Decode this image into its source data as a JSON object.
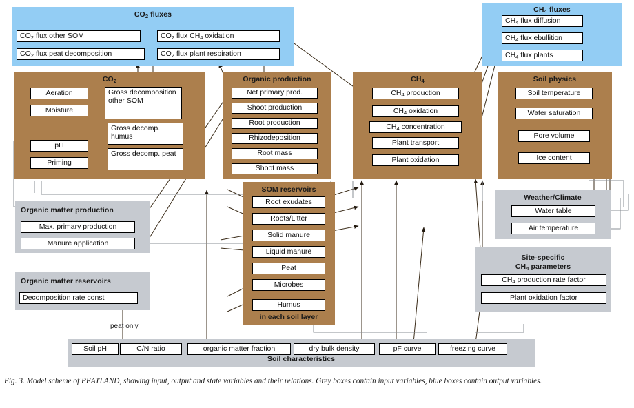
{
  "figure": {
    "caption": "Fig. 3.  Model scheme of PEATLAND, showing input, output and state variables and their relations. Grey boxes contain input variables, blue boxes contain output variables."
  },
  "colors": {
    "output_panel": "#93cdf4",
    "state_panel": "#ac7f4d",
    "input_panel": "#c6cad0",
    "node_fill": "#ffffff",
    "line": "#000000"
  },
  "panels": {
    "co2_fluxes": {
      "title": "CO2 fluxes",
      "kind": "output",
      "nodes": [
        {
          "label": "CO2 flux other SOM"
        },
        {
          "label": "CO2 flux peat decomposition"
        },
        {
          "label": "CO2 flux CH4 oxidation"
        },
        {
          "label": "CO2 flux plant respiration"
        }
      ]
    },
    "ch4_fluxes": {
      "title": "CH4 fluxes",
      "kind": "output",
      "nodes": [
        {
          "label": "CH4 flux diffusion"
        },
        {
          "label": "CH4 flux ebullition"
        },
        {
          "label": "CH4 flux plants"
        }
      ]
    },
    "co2": {
      "title": "CO2",
      "kind": "state",
      "nodes": [
        {
          "label": "Aeration"
        },
        {
          "label": "Moisture"
        },
        {
          "label": "pH"
        },
        {
          "label": "Priming"
        },
        {
          "label": "Gross decomposition other SOM"
        },
        {
          "label": "Gross decomp. humus"
        },
        {
          "label": "Gross decomp. peat"
        }
      ]
    },
    "organic_production": {
      "title": "Organic production",
      "kind": "state",
      "nodes": [
        {
          "label": "Net primary prod."
        },
        {
          "label": "Shoot production"
        },
        {
          "label": "Root production"
        },
        {
          "label": "Rhizodeposition"
        },
        {
          "label": "Root mass"
        },
        {
          "label": "Shoot mass"
        }
      ]
    },
    "ch4": {
      "title": "CH4",
      "kind": "state",
      "nodes": [
        {
          "label": "CH4 production"
        },
        {
          "label": "CH4 oxidation"
        },
        {
          "label": "CH4 concentration"
        },
        {
          "label": "Plant transport"
        },
        {
          "label": "Plant oxidation"
        }
      ]
    },
    "soil_physics": {
      "title": "Soil physics",
      "kind": "state",
      "nodes": [
        {
          "label": "Soil temperature"
        },
        {
          "label": "Water saturation"
        },
        {
          "label": "Pore volume"
        },
        {
          "label": "Ice content"
        }
      ]
    },
    "som_reservoirs": {
      "title": "SOM reservoirs",
      "footnote": "in each soil layer",
      "kind": "state",
      "nodes": [
        {
          "label": "Root exudates"
        },
        {
          "label": "Roots/Litter"
        },
        {
          "label": "Solid manure"
        },
        {
          "label": "Liquid manure"
        },
        {
          "label": "Peat"
        },
        {
          "label": "Microbes"
        },
        {
          "label": "Humus"
        }
      ]
    },
    "organic_matter_production": {
      "title": "Organic matter production",
      "kind": "input",
      "nodes": [
        {
          "label": "Max. primary production"
        },
        {
          "label": "Manure application"
        }
      ]
    },
    "organic_matter_reservoirs": {
      "title": "Organic matter reservoirs",
      "kind": "input",
      "nodes": [
        {
          "label": "Decomposition rate const"
        }
      ]
    },
    "weather_climate": {
      "title": "Weather/Climate",
      "kind": "input",
      "nodes": [
        {
          "label": "Water table"
        },
        {
          "label": "Air temperature"
        }
      ]
    },
    "site_specific_ch4": {
      "title_line1": "Site-specific",
      "title_line2": "CH4 parameters",
      "kind": "input",
      "nodes": [
        {
          "label": "CH4 production rate factor"
        },
        {
          "label": "Plant oxidation factor"
        }
      ]
    },
    "soil_characteristics": {
      "title": "Soil characteristics",
      "kind": "input",
      "nodes": [
        {
          "label": "Soil pH"
        },
        {
          "label": "C/N ratio"
        },
        {
          "label": "organic matter fraction"
        },
        {
          "label": "dry bulk density"
        },
        {
          "label": "pF curve"
        },
        {
          "label": "freezing curve"
        }
      ]
    }
  },
  "annotations": {
    "peat_only": "peat only"
  }
}
